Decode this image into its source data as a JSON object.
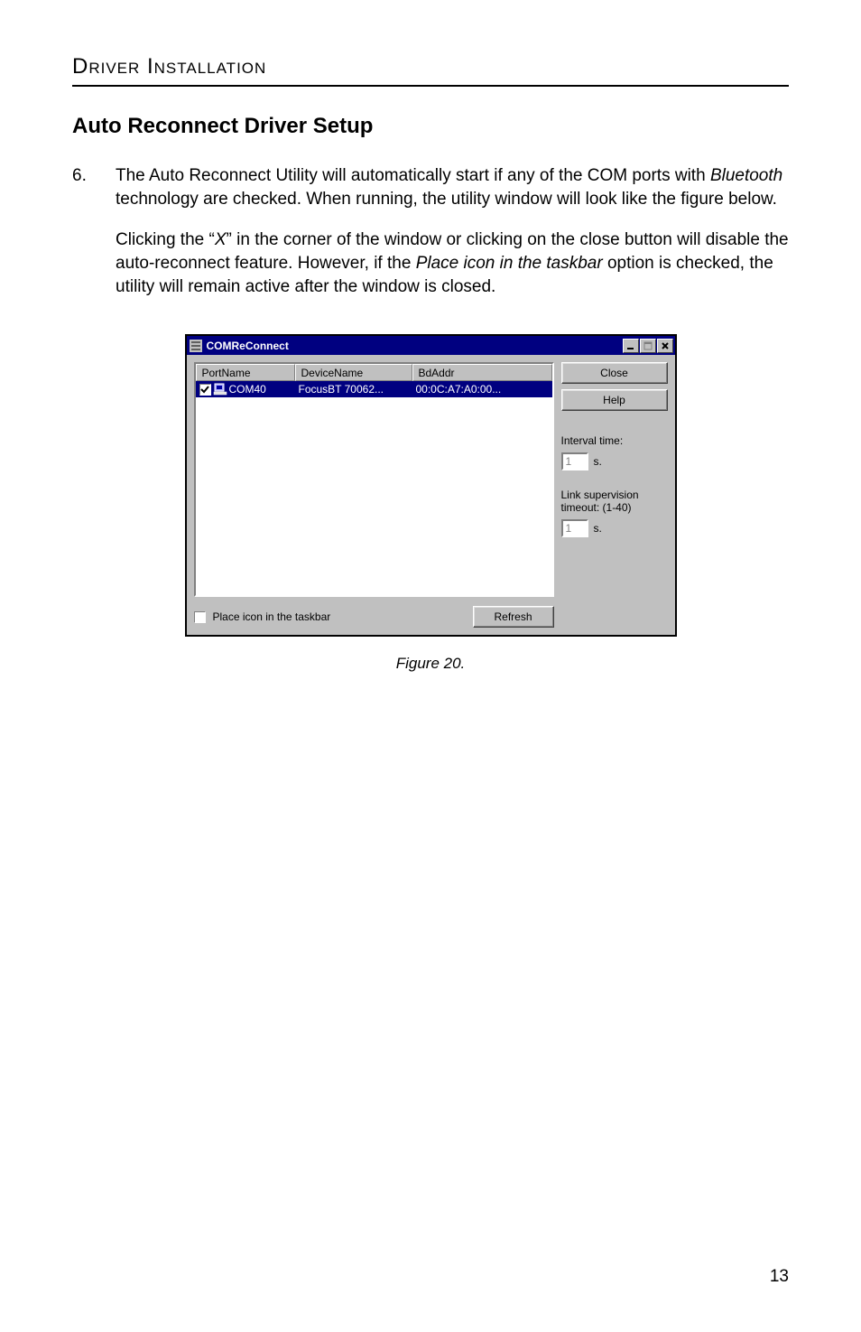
{
  "doc": {
    "section_heading": "Driver Installation",
    "subsection_heading": "Auto Reconnect Driver Setup",
    "list_number": "6.",
    "para1_a": "The Auto Reconnect Utility will automatically start if any of the COM ports with ",
    "para1_b": "Bluetooth",
    "para1_c": " technology are checked.  When running, the utility window will look like the figure below.",
    "para2_a": "Clicking the “",
    "para2_b": "X",
    "para2_c": "” in the corner of the window or clicking on the close button will disable the auto-reconnect feature.  However, if the ",
    "para2_d": "Place icon in the taskbar",
    "para2_e": " option is checked, the utility will remain active after the window is closed.",
    "figure_caption": "Figure 20.",
    "page_number": "13"
  },
  "dialog": {
    "title": "COMReConnect",
    "columns": {
      "c1": "PortName",
      "c2": "DeviceName",
      "c3": "BdAddr"
    },
    "row": {
      "port": "COM40",
      "device": "FocusBT 70062...",
      "addr": "00:0C:A7:A0:00..."
    },
    "checkbox_label": "Place icon in the taskbar",
    "refresh": "Refresh",
    "close": "Close",
    "help": "Help",
    "interval_label": "Interval time:",
    "interval_value": "1",
    "interval_unit": "s.",
    "timeout_label": "Link supervision timeout: (1-40)",
    "timeout_value": "1",
    "timeout_unit": "s."
  }
}
